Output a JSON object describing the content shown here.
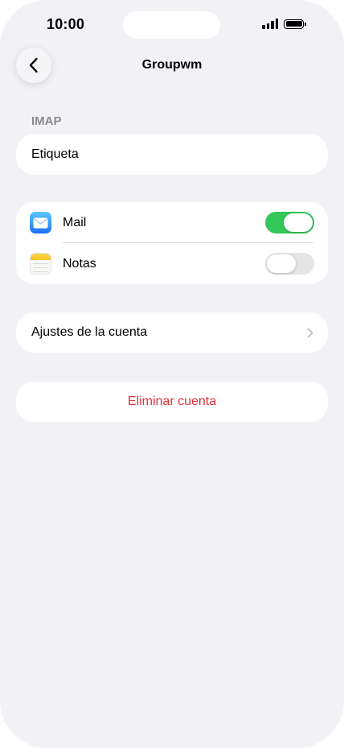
{
  "status_bar": {
    "time": "10:00"
  },
  "nav": {
    "title": "Groupwm",
    "back_icon": "chevron-left-icon"
  },
  "section": {
    "header": "IMAP"
  },
  "label_field": {
    "value": "Etiqueta"
  },
  "apps": [
    {
      "label": "Mail",
      "icon": "mail-icon",
      "enabled": true
    },
    {
      "label": "Notas",
      "icon": "notes-icon",
      "enabled": false
    }
  ],
  "account_settings": {
    "label": "Ajustes de la cuenta",
    "icon": "chevron-right-icon"
  },
  "delete_account": {
    "label": "Eliminar cuenta"
  },
  "colors": {
    "background": "#f2f1f6",
    "toggle_on": "#34c759",
    "toggle_off": "#e4e4e7",
    "destructive": "#e5333a",
    "section_header": "#8a8a8e"
  }
}
